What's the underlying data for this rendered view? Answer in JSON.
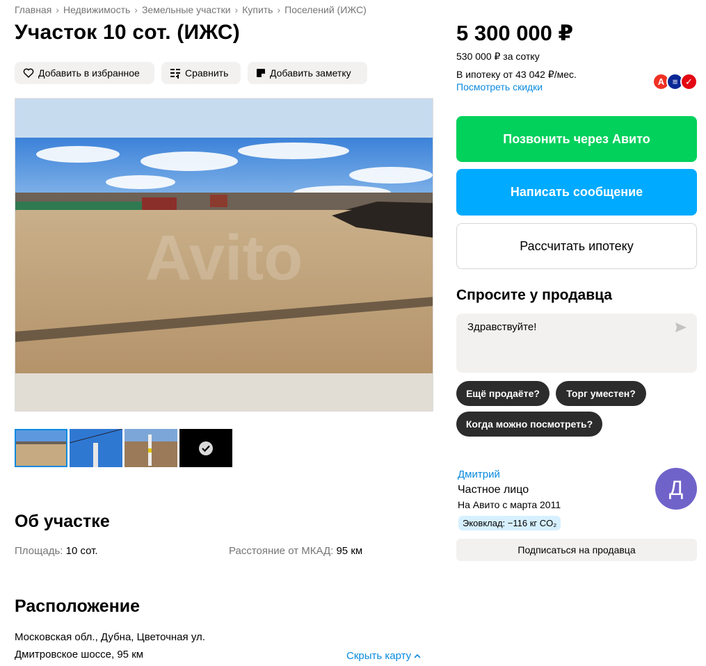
{
  "breadcrumbs": [
    "Главная",
    "Недвижимость",
    "Земельные участки",
    "Купить",
    "Поселений (ИЖС)"
  ],
  "breadcrumb_separator": "›",
  "title": "Участок 10 сот. (ИЖС)",
  "actions": {
    "favorite": "Добавить в избранное",
    "compare": "Сравнить",
    "note": "Добавить заметку"
  },
  "photo": {
    "watermark": "Avito"
  },
  "about": {
    "heading": "Об участке",
    "area_key": "Площадь: ",
    "area_value": "10 сот.",
    "distance_key": "Расстояние от МКАД: ",
    "distance_value": "95 км"
  },
  "location": {
    "heading": "Расположение",
    "address": "Московская обл., Дубна, Цветочная ул.",
    "highway": "Дмитровское шоссе, 95 км",
    "hide_map": "Скрыть карту"
  },
  "price": {
    "amount": "5 300 000 ₽",
    "per_sotka": "530 000 ₽ за сотку",
    "mortgage": "В ипотеку от 43 042 ₽/мес.",
    "discounts_link": "Посмотреть скидки"
  },
  "banks": [
    {
      "name": "alfa-bank",
      "letter": "А",
      "color": "#ef3124"
    },
    {
      "name": "vtb",
      "letter": "≡",
      "color": "#0a2896"
    },
    {
      "name": "sovcombank",
      "letter": "✓",
      "color": "#e30613"
    }
  ],
  "buttons": {
    "call": "Позвонить через Авито",
    "message": "Написать сообщение",
    "mortgage_calc": "Рассчитать ипотеку"
  },
  "ask": {
    "heading": "Спросите у продавца",
    "input_value": "Здравствуйте!",
    "chips": [
      "Ещё продаёте?",
      "Торг уместен?",
      "Когда можно посмотреть?"
    ]
  },
  "seller": {
    "name": "Дмитрий",
    "type": "Частное лицо",
    "since": "На Авито с марта 2011",
    "eco": "Эковклад: −116 кг CO₂",
    "avatar_letter": "Д",
    "subscribe": "Подписаться на продавца"
  },
  "colors": {
    "accent_green": "#02d15c",
    "accent_blue": "#00aaff",
    "link": "#0a8adf",
    "avatar": "#6f63c9"
  }
}
